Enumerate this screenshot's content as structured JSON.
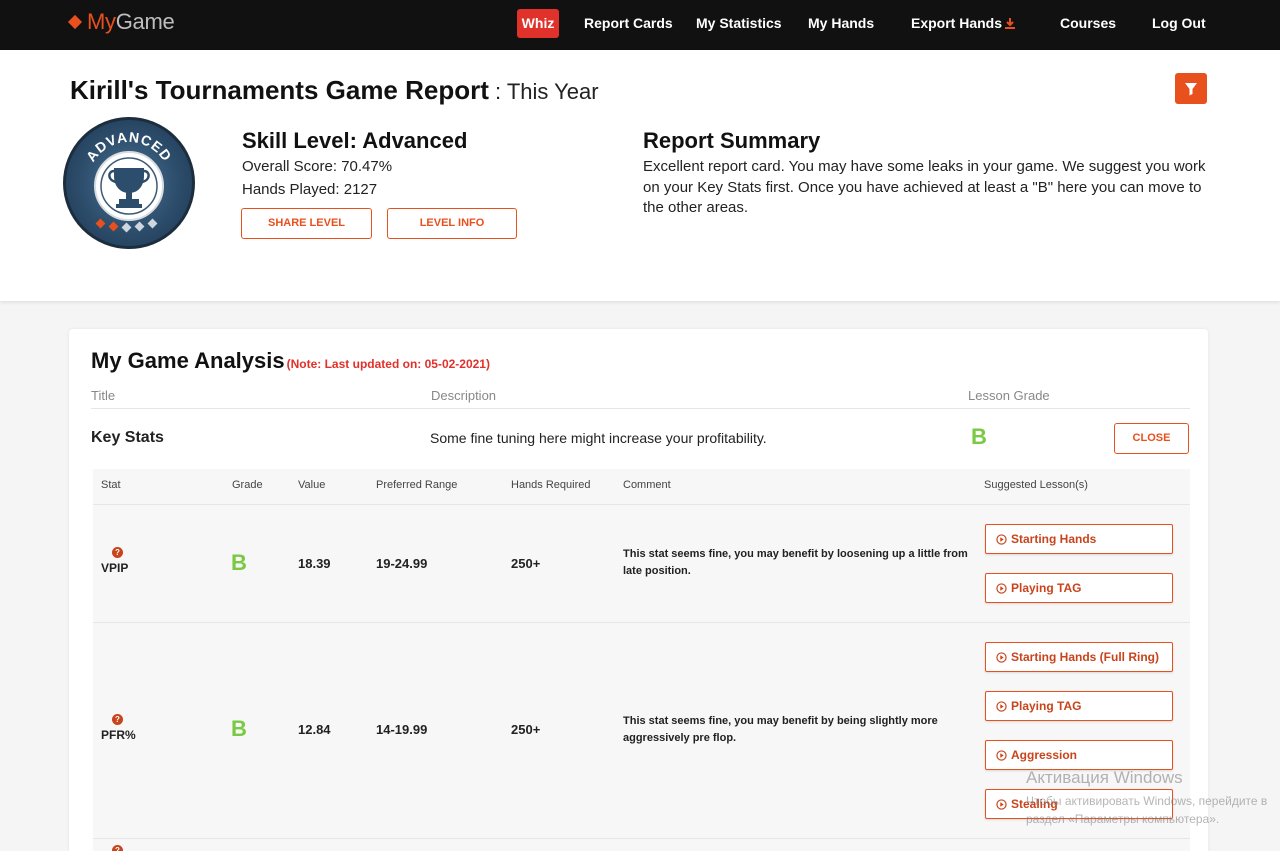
{
  "nav": {
    "logo_my": "My",
    "logo_game": "Game",
    "whiz": "Whiz",
    "report_cards": "Report Cards",
    "my_statistics": "My Statistics",
    "my_hands": "My Hands",
    "export_hands": "Export Hands",
    "courses": "Courses",
    "log_out": "Log Out"
  },
  "header": {
    "title": "Kirill's Tournaments Game Report",
    "period": " : This Year",
    "badge_text": "ADVANCED",
    "skill_level": "Skill Level: Advanced",
    "overall_score": "Overall Score: 70.47%",
    "hands_played": "Hands Played: 2127",
    "share_level": "SHARE LEVEL",
    "level_info": "LEVEL INFO",
    "summary_title": "Report Summary",
    "summary_text": "Excellent report card. You may have some leaks in your game. We suggest you work on your Key Stats first. Once you have achieved at least a \"B\" here you can move to the other areas."
  },
  "analysis": {
    "title": "My Game Analysis",
    "note": "(Note: Last updated on: 05-02-2021)",
    "columns": [
      "Title",
      "Description",
      "Lesson Grade"
    ],
    "section": {
      "title": "Key Stats",
      "description": "Some fine tuning here might increase your profitability.",
      "grade": "B",
      "close": "CLOSE"
    },
    "stat_columns": [
      "Stat",
      "Grade",
      "Value",
      "Preferred Range",
      "Hands Required",
      "Comment",
      "Suggested Lesson(s)"
    ],
    "stats": [
      {
        "name": "VPIP",
        "grade": "B",
        "value": "18.39",
        "range": "19-24.99",
        "hands": "250+",
        "comment": "This stat seems fine, you may benefit by loosening up a little from late position.",
        "lessons": [
          "Starting Hands",
          "Playing TAG"
        ]
      },
      {
        "name": "PFR%",
        "grade": "B",
        "value": "12.84",
        "range": "14-19.99",
        "hands": "250+",
        "comment": "This stat seems fine, you may benefit by being slightly more aggressively pre flop.",
        "lessons": [
          "Starting Hands (Full Ring)",
          "Playing TAG",
          "Aggression",
          "Stealing"
        ]
      }
    ]
  },
  "watermark": {
    "title": "Активация Windows",
    "subtitle": "Чтобы активировать Windows, перейдите в раздел «Параметры компьютера»."
  },
  "colors": {
    "brand": "#e8501e",
    "whiz": "#e0312b",
    "grade": "#7ac943",
    "nav_bg": "#111111"
  }
}
